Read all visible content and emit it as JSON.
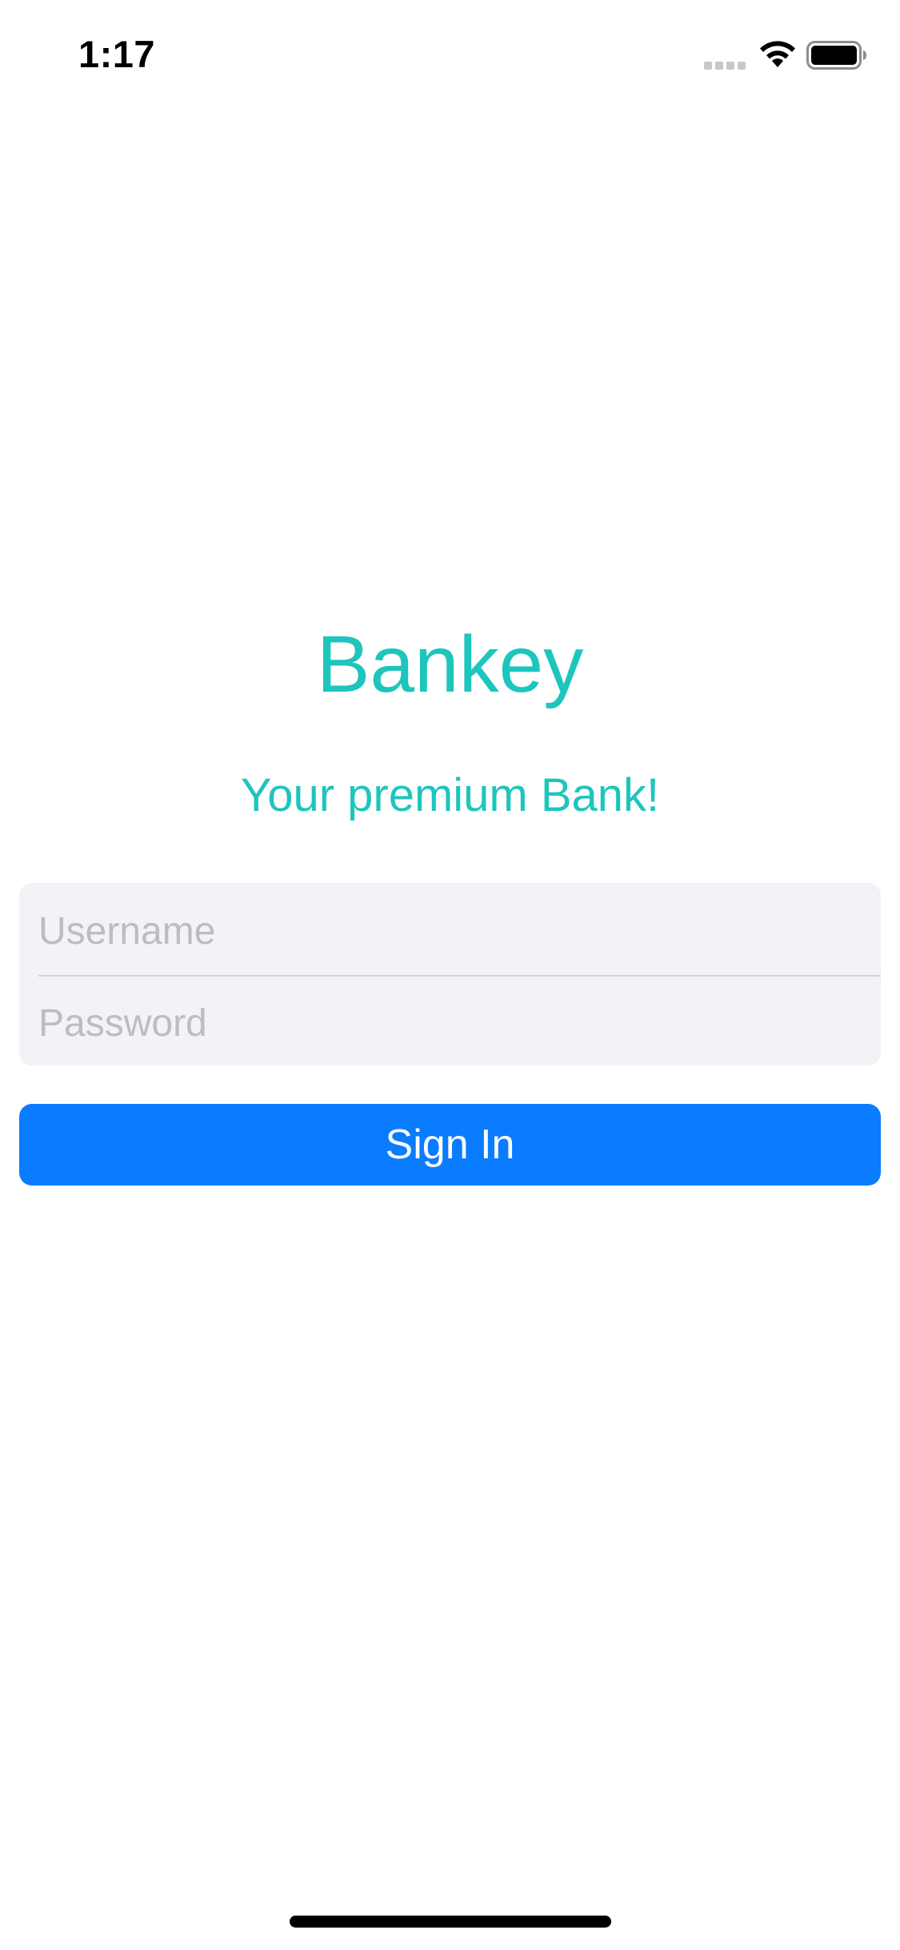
{
  "status_bar": {
    "time": "1:17",
    "icons": [
      "cellular-signal-icon",
      "wifi-icon",
      "battery-icon"
    ]
  },
  "app": {
    "title": "Bankey",
    "subtitle": "Your premium Bank!",
    "accent_color": "#1ec5bd"
  },
  "login": {
    "username_placeholder": "Username",
    "username_value": "",
    "password_placeholder": "Password",
    "password_value": "",
    "signin_label": "Sign In",
    "button_color": "#0a7cff"
  }
}
